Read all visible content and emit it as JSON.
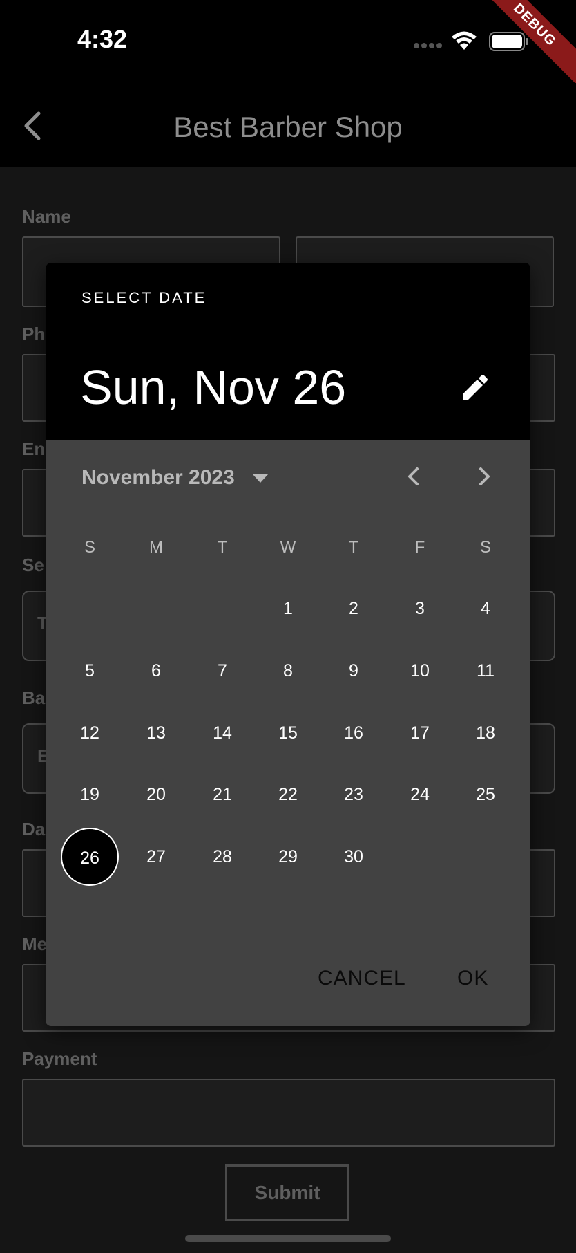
{
  "status": {
    "time": "4:32",
    "debug": "DEBUG"
  },
  "appbar": {
    "title": "Best Barber Shop"
  },
  "form": {
    "name_label": "Name",
    "phone_label": "Ph",
    "email_label": "En",
    "service_label": "Se",
    "service_value": "T",
    "barber_label": "Ba",
    "barber_value": "E",
    "date_label": "Da",
    "message_label": "Me",
    "payment_label": "Payment",
    "submit_label": "Submit"
  },
  "picker": {
    "heading": "SELECT DATE",
    "selected_date": "Sun, Nov 26",
    "month_label": "November 2023",
    "weekdays": [
      "S",
      "M",
      "T",
      "W",
      "T",
      "F",
      "S"
    ],
    "weeks": [
      [
        "",
        "",
        "",
        "1",
        "2",
        "3",
        "4"
      ],
      [
        "5",
        "6",
        "7",
        "8",
        "9",
        "10",
        "11"
      ],
      [
        "12",
        "13",
        "14",
        "15",
        "16",
        "17",
        "18"
      ],
      [
        "19",
        "20",
        "21",
        "22",
        "23",
        "24",
        "25"
      ],
      [
        "26",
        "27",
        "28",
        "29",
        "30",
        "",
        ""
      ]
    ],
    "selected_day": "26",
    "cancel_label": "CANCEL",
    "ok_label": "OK"
  }
}
